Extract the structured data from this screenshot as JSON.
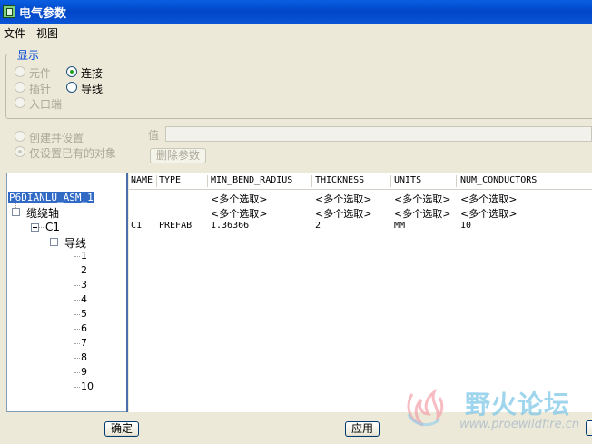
{
  "window": {
    "title": "电气参数"
  },
  "menu": [
    {
      "label": "文件"
    },
    {
      "label": "视图"
    }
  ],
  "display_group": {
    "legend": "显示",
    "options": [
      {
        "label": "元件",
        "checked": false,
        "disabled": true
      },
      {
        "label": "插针",
        "checked": false,
        "disabled": true
      },
      {
        "label": "入口端",
        "checked": false,
        "disabled": true
      },
      {
        "label": "连接",
        "checked": true,
        "disabled": false
      },
      {
        "label": "导线",
        "checked": false,
        "disabled": false
      }
    ]
  },
  "mode_options": [
    {
      "label": "创建并设置",
      "checked": false,
      "disabled": true
    },
    {
      "label": "仅设置已有的对象",
      "checked": true,
      "disabled": true
    }
  ],
  "value_field": {
    "label": "值",
    "value": ""
  },
  "delete_button": {
    "label": "删除参数"
  },
  "tree": {
    "root": "P6DIANLU_ASM_1",
    "child": "缆绕轴",
    "grandchild": "C1",
    "folder": "导线",
    "leaves": [
      "1",
      "2",
      "3",
      "4",
      "5",
      "6",
      "7",
      "8",
      "9",
      "10"
    ]
  },
  "table": {
    "columns": [
      "NAME",
      "TYPE",
      "MIN_BEND_RADIUS",
      "THICKNESS",
      "UNITS",
      "NUM_CONDUCTORS"
    ],
    "rows": [
      [
        "",
        "",
        "<多个选取>",
        "<多个选取>",
        "<多个选取>",
        "<多个选取>"
      ],
      [
        "",
        "",
        "<多个选取>",
        "<多个选取>",
        "<多个选取>",
        "<多个选取>"
      ],
      [
        "C1",
        "PREFAB",
        "1.36366",
        "2",
        "MM",
        "10"
      ]
    ]
  },
  "buttons": {
    "ok": "确定",
    "apply": "应用"
  },
  "watermark": {
    "title": "野火论坛",
    "url": "www.proewildfire.cn"
  },
  "colors": {
    "titlebar": "#0a5fe0",
    "selection": "#316ac5",
    "legend": "#0046d5"
  }
}
